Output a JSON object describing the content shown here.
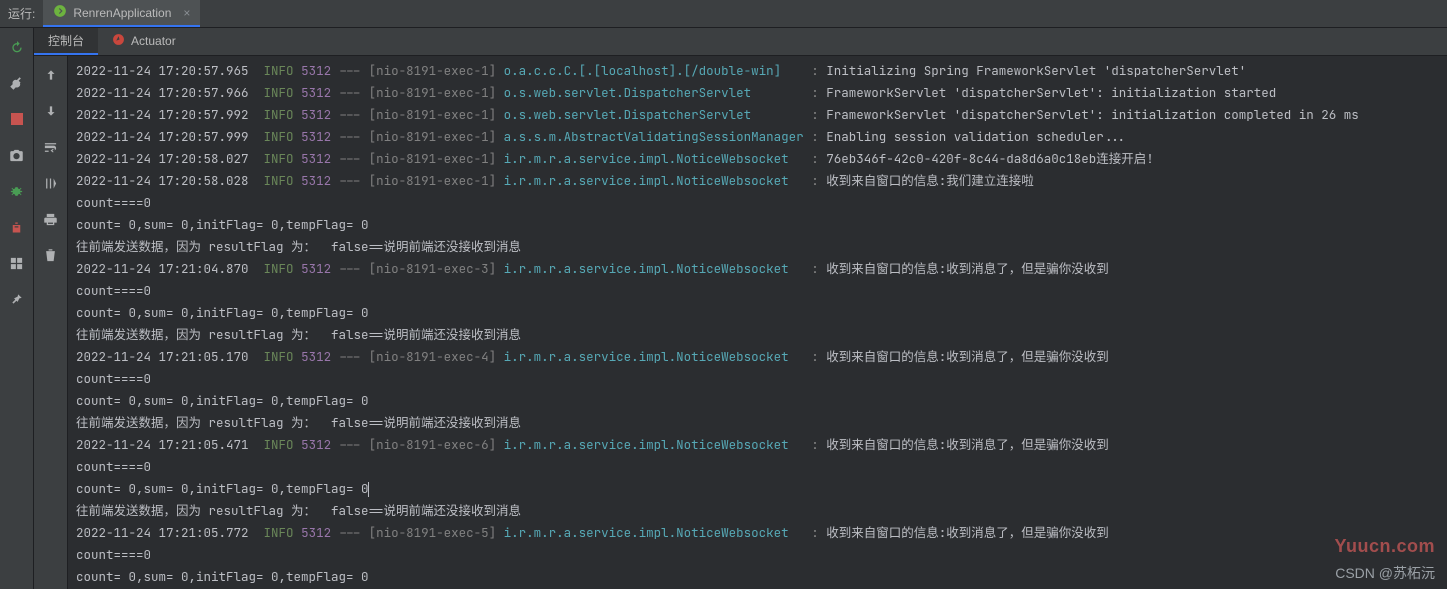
{
  "toolWindow": {
    "title": "运行:"
  },
  "runConfig": {
    "name": "RenrenApplication"
  },
  "subTabs": {
    "console": "控制台",
    "actuator": "Actuator"
  },
  "level": {
    "info": "INFO"
  },
  "pid": "5312",
  "dashes": "---",
  "sep": ":",
  "lines": [
    {
      "type": "log",
      "ts": "2022-11-24 17:20:57.965",
      "thr": "[nio-8191-exec-1]",
      "logger": "o.a.c.c.C.[.[localhost].[/double-win]   ",
      "msg": "Initializing Spring FrameworkServlet 'dispatcherServlet'"
    },
    {
      "type": "log",
      "ts": "2022-11-24 17:20:57.966",
      "thr": "[nio-8191-exec-1]",
      "logger": "o.s.web.servlet.DispatcherServlet       ",
      "msg": "FrameworkServlet 'dispatcherServlet': initialization started"
    },
    {
      "type": "log",
      "ts": "2022-11-24 17:20:57.992",
      "thr": "[nio-8191-exec-1]",
      "logger": "o.s.web.servlet.DispatcherServlet       ",
      "msg": "FrameworkServlet 'dispatcherServlet': initialization completed in 26 ms"
    },
    {
      "type": "log",
      "ts": "2022-11-24 17:20:57.999",
      "thr": "[nio-8191-exec-1]",
      "logger": "a.s.s.m.AbstractValidatingSessionManager",
      "msg": "Enabling session validation scheduler..."
    },
    {
      "type": "log",
      "ts": "2022-11-24 17:20:58.027",
      "thr": "[nio-8191-exec-1]",
      "logger": "i.r.m.r.a.service.impl.NoticeWebsocket  ",
      "msg": "76eb346f-42c0-420f-8c44-da8d6a0c18eb连接开启!"
    },
    {
      "type": "log",
      "ts": "2022-11-24 17:20:58.028",
      "thr": "[nio-8191-exec-1]",
      "logger": "i.r.m.r.a.service.impl.NoticeWebsocket  ",
      "msg": "收到来自窗口的信息:我们建立连接啦"
    },
    {
      "type": "plain",
      "text": "count====0"
    },
    {
      "type": "plain",
      "text": "count= 0,sum= 0,initFlag= 0,tempFlag= 0"
    },
    {
      "type": "plain",
      "text": "往前端发送数据，因为 resultFlag 为：  false==说明前端还没接收到消息"
    },
    {
      "type": "log",
      "ts": "2022-11-24 17:21:04.870",
      "thr": "[nio-8191-exec-3]",
      "logger": "i.r.m.r.a.service.impl.NoticeWebsocket  ",
      "msg": "收到来自窗口的信息:收到消息了，但是骗你没收到"
    },
    {
      "type": "plain",
      "text": "count====0"
    },
    {
      "type": "plain",
      "text": "count= 0,sum= 0,initFlag= 0,tempFlag= 0"
    },
    {
      "type": "plain",
      "text": "往前端发送数据，因为 resultFlag 为：  false==说明前端还没接收到消息"
    },
    {
      "type": "log",
      "ts": "2022-11-24 17:21:05.170",
      "thr": "[nio-8191-exec-4]",
      "logger": "i.r.m.r.a.service.impl.NoticeWebsocket  ",
      "msg": "收到来自窗口的信息:收到消息了，但是骗你没收到"
    },
    {
      "type": "plain",
      "text": "count====0"
    },
    {
      "type": "plain",
      "text": "count= 0,sum= 0,initFlag= 0,tempFlag= 0"
    },
    {
      "type": "plain",
      "text": "往前端发送数据，因为 resultFlag 为：  false==说明前端还没接收到消息"
    },
    {
      "type": "log",
      "ts": "2022-11-24 17:21:05.471",
      "thr": "[nio-8191-exec-6]",
      "logger": "i.r.m.r.a.service.impl.NoticeWebsocket  ",
      "msg": "收到来自窗口的信息:收到消息了，但是骗你没收到"
    },
    {
      "type": "plain",
      "text": "count====0"
    },
    {
      "type": "plain",
      "text": "count= 0,sum= 0,initFlag= 0,tempFlag= 0",
      "caret": true
    },
    {
      "type": "plain",
      "text": "往前端发送数据，因为 resultFlag 为：  false==说明前端还没接收到消息"
    },
    {
      "type": "log",
      "ts": "2022-11-24 17:21:05.772",
      "thr": "[nio-8191-exec-5]",
      "logger": "i.r.m.r.a.service.impl.NoticeWebsocket  ",
      "msg": "收到来自窗口的信息:收到消息了，但是骗你没收到"
    },
    {
      "type": "plain",
      "text": "count====0"
    },
    {
      "type": "plain",
      "text": "count= 0,sum= 0,initFlag= 0,tempFlag= 0"
    }
  ],
  "watermark": {
    "site": "Yuucn.com",
    "author": "CSDN @苏柘沅"
  }
}
